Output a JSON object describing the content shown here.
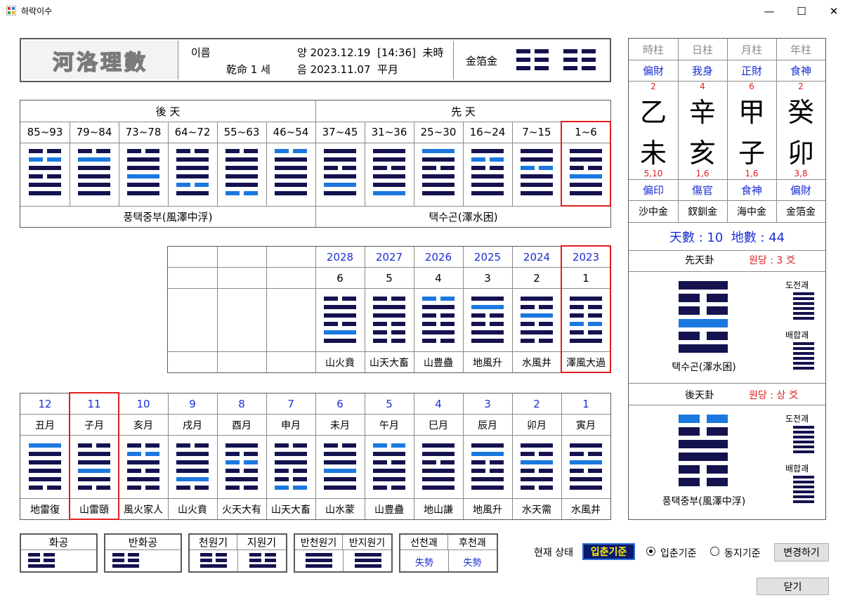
{
  "window": {
    "title": "하락이수",
    "min": "—",
    "max": "☐",
    "close": "✕"
  },
  "header": {
    "logo": "河洛理數",
    "name_label": "이름",
    "gan_label": "乾命 1 세",
    "solar": "양 2023.12.19  [14:36]  未時",
    "lunar": "음 2023.11.07  平月",
    "napeum": "金箔金",
    "hex1": [
      [
        1,
        0,
        1
      ],
      [
        1,
        0,
        1
      ],
      [
        1,
        0,
        1
      ]
    ],
    "hex2": [
      [
        1,
        0,
        1
      ],
      [
        1,
        0,
        1
      ],
      [
        1,
        0,
        1
      ]
    ]
  },
  "colors": {
    "navy": "#14124f",
    "blue": "#1b78e0",
    "red": "#e02020"
  },
  "gua_table": {
    "left_title": "後 天",
    "right_title": "先 天",
    "ranges": [
      "85~93",
      "79~84",
      "73~78",
      "64~72",
      "55~63",
      "46~54",
      "37~45",
      "31~36",
      "25~30",
      "16~24",
      "7~15",
      "1~6"
    ],
    "hexes": [
      [
        [
          1,
          0,
          0
        ],
        [
          1,
          1,
          0
        ],
        [
          0,
          0,
          0
        ],
        [
          1,
          0,
          0
        ],
        [
          0,
          0,
          0
        ],
        [
          0,
          0,
          0
        ]
      ],
      [
        [
          1,
          0,
          0
        ],
        [
          0,
          1,
          1
        ],
        [
          0,
          0,
          0
        ],
        [
          0,
          0,
          0
        ],
        [
          0,
          0,
          0
        ],
        [
          0,
          0,
          0
        ]
      ],
      [
        [
          1,
          0,
          0
        ],
        [
          0,
          0,
          0
        ],
        [
          0,
          0,
          0
        ],
        [
          0,
          1,
          1
        ],
        [
          0,
          0,
          0
        ],
        [
          0,
          0,
          0
        ]
      ],
      [
        [
          1,
          0,
          0
        ],
        [
          0,
          0,
          0
        ],
        [
          0,
          0,
          0
        ],
        [
          0,
          0,
          0
        ],
        [
          1,
          1,
          0
        ],
        [
          0,
          0,
          0
        ]
      ],
      [
        [
          1,
          0,
          0
        ],
        [
          0,
          0,
          0
        ],
        [
          0,
          0,
          0
        ],
        [
          0,
          0,
          0
        ],
        [
          0,
          0,
          0
        ],
        [
          1,
          1,
          0
        ]
      ],
      [
        [
          1,
          1,
          0
        ],
        [
          0,
          0,
          0
        ],
        [
          0,
          0,
          0
        ],
        [
          0,
          0,
          0
        ],
        [
          0,
          0,
          0
        ],
        [
          0,
          0,
          0
        ]
      ],
      [
        [
          0,
          0,
          0
        ],
        [
          0,
          0,
          0
        ],
        [
          1,
          0,
          0
        ],
        [
          0,
          0,
          0
        ],
        [
          0,
          1,
          1
        ],
        [
          0,
          0,
          0
        ]
      ],
      [
        [
          0,
          0,
          0
        ],
        [
          0,
          0,
          0
        ],
        [
          1,
          0,
          0
        ],
        [
          0,
          0,
          0
        ],
        [
          0,
          0,
          0
        ],
        [
          0,
          1,
          1
        ]
      ],
      [
        [
          0,
          1,
          1
        ],
        [
          0,
          0,
          0
        ],
        [
          1,
          0,
          0
        ],
        [
          0,
          0,
          0
        ],
        [
          0,
          0,
          0
        ],
        [
          0,
          0,
          0
        ]
      ],
      [
        [
          0,
          0,
          0
        ],
        [
          1,
          1,
          0
        ],
        [
          1,
          0,
          0
        ],
        [
          0,
          0,
          0
        ],
        [
          0,
          0,
          0
        ],
        [
          0,
          0,
          0
        ]
      ],
      [
        [
          0,
          0,
          0
        ],
        [
          0,
          0,
          0
        ],
        [
          1,
          1,
          0
        ],
        [
          0,
          0,
          0
        ],
        [
          0,
          0,
          0
        ],
        [
          0,
          0,
          0
        ]
      ],
      [
        [
          0,
          0,
          0
        ],
        [
          0,
          0,
          0
        ],
        [
          1,
          0,
          0
        ],
        [
          0,
          1,
          1
        ],
        [
          0,
          0,
          0
        ],
        [
          0,
          0,
          0
        ]
      ]
    ],
    "left_name": "풍택중부(風澤中浮)",
    "right_name": "택수곤(澤水困)"
  },
  "year_table": {
    "years": [
      "2028",
      "2027",
      "2026",
      "2025",
      "2024",
      "2023"
    ],
    "nums": [
      "6",
      "5",
      "4",
      "3",
      "2",
      "1"
    ],
    "hexes": [
      [
        [
          1,
          0,
          0
        ],
        [
          0,
          0,
          0
        ],
        [
          0,
          0,
          0
        ],
        [
          1,
          0,
          0
        ],
        [
          0,
          1,
          1
        ],
        [
          0,
          0,
          0
        ]
      ],
      [
        [
          1,
          0,
          0
        ],
        [
          0,
          0,
          0
        ],
        [
          0,
          0,
          0
        ],
        [
          1,
          0,
          0
        ],
        [
          1,
          0,
          0
        ],
        [
          1,
          0,
          0
        ]
      ],
      [
        [
          1,
          1,
          0
        ],
        [
          0,
          0,
          0
        ],
        [
          1,
          0,
          0
        ],
        [
          1,
          0,
          0
        ],
        [
          0,
          0,
          0
        ],
        [
          1,
          0,
          0
        ]
      ],
      [
        [
          0,
          0,
          0
        ],
        [
          0,
          1,
          1
        ],
        [
          1,
          0,
          0
        ],
        [
          1,
          0,
          0
        ],
        [
          0,
          0,
          0
        ],
        [
          0,
          0,
          0
        ]
      ],
      [
        [
          0,
          0,
          0
        ],
        [
          1,
          0,
          0
        ],
        [
          0,
          1,
          1
        ],
        [
          1,
          0,
          0
        ],
        [
          0,
          0,
          0
        ],
        [
          1,
          0,
          0
        ]
      ],
      [
        [
          0,
          0,
          0
        ],
        [
          1,
          0,
          0
        ],
        [
          1,
          0,
          0
        ],
        [
          1,
          1,
          0
        ],
        [
          1,
          0,
          0
        ],
        [
          0,
          0,
          0
        ]
      ]
    ],
    "names": [
      "山火賁",
      "山天大畜",
      "山豊蠱",
      "地風升",
      "水風井",
      "澤風大過"
    ]
  },
  "month_table": {
    "nums": [
      "12",
      "11",
      "10",
      "9",
      "8",
      "7",
      "6",
      "5",
      "4",
      "3",
      "2",
      "1"
    ],
    "months": [
      "丑月",
      "子月",
      "亥月",
      "戌月",
      "酉月",
      "申月",
      "未月",
      "午月",
      "巳月",
      "辰月",
      "卯月",
      "寅月"
    ],
    "hexes": [
      [
        [
          0,
          1,
          1
        ],
        [
          0,
          0,
          0
        ],
        [
          0,
          0,
          0
        ],
        [
          0,
          0,
          0
        ],
        [
          0,
          0,
          0
        ],
        [
          1,
          0,
          0
        ]
      ],
      [
        [
          1,
          0,
          0
        ],
        [
          0,
          0,
          0
        ],
        [
          0,
          0,
          0
        ],
        [
          0,
          1,
          1
        ],
        [
          0,
          0,
          0
        ],
        [
          1,
          0,
          0
        ]
      ],
      [
        [
          1,
          0,
          0
        ],
        [
          1,
          1,
          0
        ],
        [
          0,
          0,
          0
        ],
        [
          1,
          0,
          0
        ],
        [
          0,
          0,
          0
        ],
        [
          1,
          0,
          0
        ]
      ],
      [
        [
          1,
          0,
          0
        ],
        [
          0,
          0,
          0
        ],
        [
          0,
          0,
          0
        ],
        [
          0,
          0,
          0
        ],
        [
          0,
          1,
          1
        ],
        [
          1,
          0,
          0
        ]
      ],
      [
        [
          0,
          0,
          0
        ],
        [
          1,
          0,
          0
        ],
        [
          1,
          1,
          0
        ],
        [
          1,
          0,
          0
        ],
        [
          0,
          0,
          0
        ],
        [
          1,
          0,
          0
        ]
      ],
      [
        [
          1,
          0,
          0
        ],
        [
          0,
          0,
          0
        ],
        [
          0,
          0,
          0
        ],
        [
          1,
          0,
          0
        ],
        [
          1,
          0,
          0
        ],
        [
          1,
          1,
          0
        ]
      ],
      [
        [
          1,
          0,
          0
        ],
        [
          0,
          0,
          0
        ],
        [
          0,
          0,
          0
        ],
        [
          0,
          1,
          1
        ],
        [
          0,
          0,
          0
        ],
        [
          0,
          0,
          0
        ]
      ],
      [
        [
          1,
          1,
          0
        ],
        [
          0,
          0,
          0
        ],
        [
          1,
          0,
          0
        ],
        [
          0,
          0,
          0
        ],
        [
          0,
          0,
          0
        ],
        [
          1,
          0,
          0
        ]
      ],
      [
        [
          0,
          0,
          0
        ],
        [
          0,
          0,
          0
        ],
        [
          1,
          0,
          0
        ],
        [
          0,
          0,
          0
        ],
        [
          0,
          0,
          0
        ],
        [
          0,
          0,
          0
        ]
      ],
      [
        [
          0,
          0,
          0
        ],
        [
          0,
          1,
          1
        ],
        [
          1,
          0,
          0
        ],
        [
          1,
          0,
          0
        ],
        [
          0,
          0,
          0
        ],
        [
          0,
          0,
          0
        ]
      ],
      [
        [
          0,
          0,
          0
        ],
        [
          1,
          0,
          0
        ],
        [
          0,
          1,
          1
        ],
        [
          1,
          0,
          0
        ],
        [
          0,
          0,
          0
        ],
        [
          1,
          0,
          0
        ]
      ],
      [
        [
          0,
          0,
          0
        ],
        [
          1,
          0,
          0
        ],
        [
          0,
          1,
          1
        ],
        [
          1,
          0,
          0
        ],
        [
          0,
          0,
          0
        ],
        [
          0,
          0,
          0
        ]
      ]
    ],
    "names": [
      "地雷復",
      "山雷頤",
      "風火家人",
      "山火賁",
      "火天大有",
      "山天大畜",
      "山水蒙",
      "山豊蠱",
      "地山謙",
      "地風升",
      "水天需",
      "水風井"
    ]
  },
  "saju": {
    "headers": [
      "時柱",
      "日柱",
      "月柱",
      "年柱"
    ],
    "top_gods": [
      "偏財",
      "我身",
      "正財",
      "食神"
    ],
    "top_nums": [
      "2",
      "4",
      "6",
      "2"
    ],
    "stems": [
      "乙",
      "辛",
      "甲",
      "癸"
    ],
    "branches": [
      "未",
      "亥",
      "子",
      "卯"
    ],
    "bottom_nums": [
      "5,10",
      "1,6",
      "1,6",
      "3,8"
    ],
    "bottom_gods": [
      "偏印",
      "傷官",
      "食神",
      "偏財"
    ],
    "napeum": [
      "沙中金",
      "釵釧金",
      "海中金",
      "金箔金"
    ],
    "numbers": "天數 : 10  地數 : 44"
  },
  "pre_gua": {
    "title": "先天卦",
    "wondang": "원당 : 3 爻",
    "name": "택수곤(澤水困)",
    "lines": [
      [
        0,
        0,
        0
      ],
      [
        1,
        0,
        0
      ],
      [
        1,
        0,
        0
      ],
      [
        0,
        1,
        1
      ],
      [
        1,
        0,
        0
      ],
      [
        0,
        0,
        0
      ]
    ],
    "dojeon": "도전괘",
    "baehap": "배합괘"
  },
  "post_gua": {
    "title": "後天卦",
    "wondang": "원당 : 상 爻",
    "name": "풍택중부(風澤中浮)",
    "lines": [
      [
        1,
        1,
        0
      ],
      [
        1,
        0,
        0
      ],
      [
        0,
        0,
        0
      ],
      [
        0,
        0,
        0
      ],
      [
        1,
        0,
        0
      ],
      [
        1,
        0,
        0
      ]
    ],
    "dojeon": "도전괘",
    "baehap": "배합괘"
  },
  "bottom": {
    "hwagong": "화공",
    "banhwagong": "반화공",
    "cheonwongi": "천원기",
    "jiwongi": "지원기",
    "bancheon": "반천원기",
    "banji": "반지원기",
    "seoncheon": "선천괘",
    "hucheon": "후천괘",
    "seon_val": "失勢",
    "hu_val": "失勢",
    "status_label": "현재 상태",
    "status_value": "입춘기준",
    "radio1": "입춘기준",
    "radio2": "동지기준",
    "change_btn": "변경하기",
    "close_btn": "닫기"
  }
}
